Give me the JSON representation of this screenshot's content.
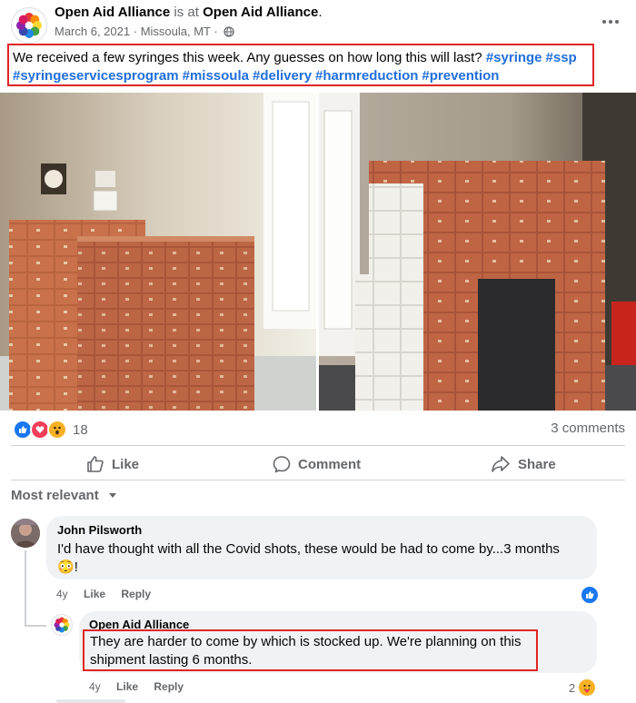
{
  "post": {
    "author": "Open Aid Alliance",
    "is_at": "is at",
    "location_page": "Open Aid Alliance",
    "period": ".",
    "date": "March 6, 2021",
    "sep1": "·",
    "place": "Missoula, MT",
    "sep2": "·",
    "text": "We received a few syringes this week.  Any guesses on how long this will last?",
    "hashtags": [
      "#syringe",
      "#ssp",
      "#syringeservicesprogram",
      "#missoula",
      "#delivery",
      "#harmreduction",
      "#prevention"
    ],
    "more_icon": "more-horizontal-icon",
    "privacy_icon": "globe-icon"
  },
  "engagement": {
    "reaction_count": "18",
    "reaction_icons": [
      "like-icon",
      "love-icon",
      "wow-icon"
    ],
    "comments_count": "3 comments"
  },
  "actions": {
    "like": "Like",
    "comment": "Comment",
    "share": "Share"
  },
  "sort": {
    "label": "Most relevant"
  },
  "comments": [
    {
      "author": "John Pilsworth",
      "text": "I'd have thought with all the Covid shots, these would be had to come by...3 months",
      "emoji": "😳",
      "tail": "!",
      "age": "4y",
      "like": "Like",
      "reply": "Reply",
      "reactions": [
        "like-icon"
      ]
    },
    {
      "author": "Open Aid Alliance",
      "text": "They are harder to come by which is stocked up. We're planning on this shipment lasting 6 months.",
      "age": "4y",
      "like": "Like",
      "reply": "Reply",
      "reaction_count": "2",
      "reactions": [
        "care-icon"
      ]
    }
  ],
  "colors": {
    "hashtag": "#216fdb",
    "highlight_border": "#e02424",
    "like_blue": "#1877f2",
    "love_red": "#f33e58",
    "muted_text": "#65676b",
    "bubble_bg": "#f0f2f5"
  }
}
